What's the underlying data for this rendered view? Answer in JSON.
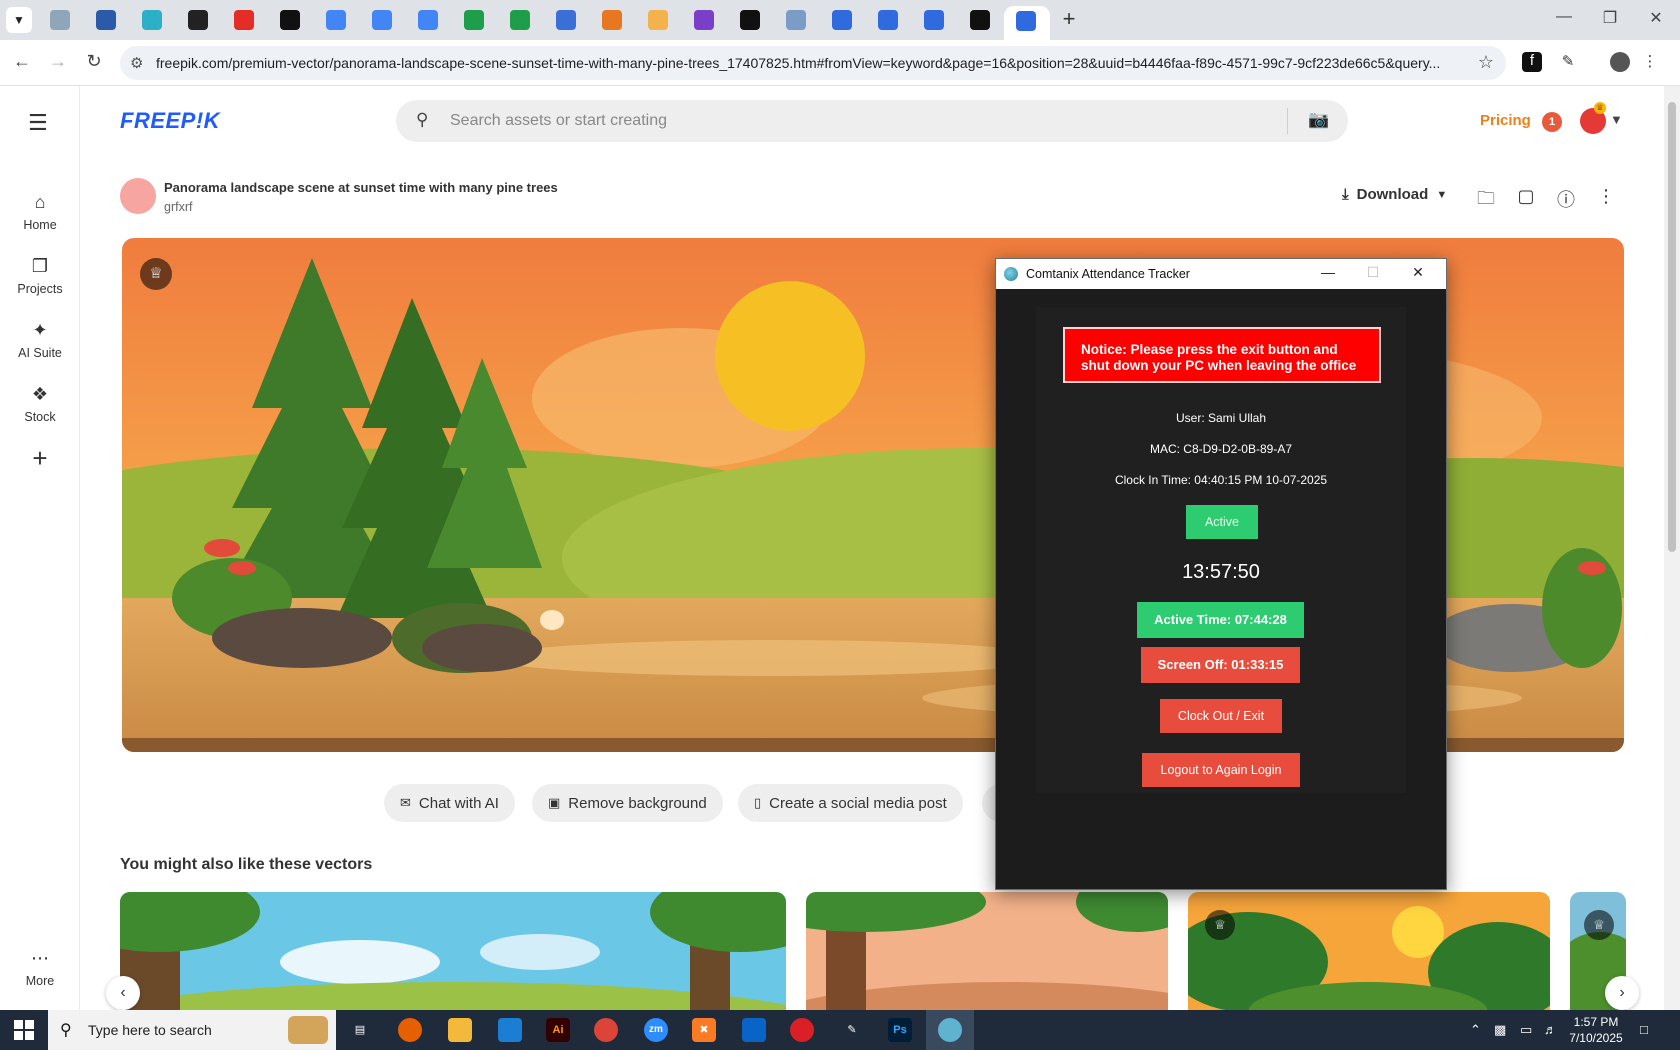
{
  "browser": {
    "url": "freepik.com/premium-vector/panorama-landscape-scene-sunset-time-with-many-pine-trees_17407825.htm#fromView=keyword&page=16&position=28&uuid=b4446faa-f89c-4571-99c7-9cf223de66c5&query...",
    "tab_colors": [
      "#8fa6b8",
      "#2b5aa8",
      "#2bb0c8",
      "#222",
      "#e52d27",
      "#111",
      "#4285f4",
      "#4285f4",
      "#4285f4",
      "#1e9e4a",
      "#1e9e4a",
      "#3a6fd8",
      "#e87722",
      "#f3b24c",
      "#7a3fc9",
      "#111",
      "#7a9cc6",
      "#2f6bde",
      "#2f6bde",
      "#2f6bde",
      "#111",
      "#2f6bde"
    ]
  },
  "site": {
    "logo": "FREEP!K",
    "search_placeholder": "Search assets or start creating",
    "pricing": "Pricing",
    "notif_count": "1"
  },
  "leftnav": {
    "items": [
      {
        "label": "Home",
        "icon": "home-icon"
      },
      {
        "label": "Projects",
        "icon": "projects-icon"
      },
      {
        "label": "AI Suite",
        "icon": "sparkle-icon"
      },
      {
        "label": "Stock",
        "icon": "stock-icon"
      }
    ],
    "more": "More"
  },
  "asset": {
    "title": "Panorama landscape scene at sunset time with many pine trees",
    "author": "grfxrf",
    "download": "Download"
  },
  "chips": [
    "Chat with AI",
    "Remove background",
    "Create a social media post"
  ],
  "recommendations": {
    "title": "You might also like these vectors"
  },
  "tracker": {
    "title": "Comtanix Attendance Tracker",
    "notice": "Notice: Please press the exit button and shut down your PC when leaving the office",
    "user": "User: Sami Ullah",
    "mac": "MAC: C8-D9-D2-0B-89-A7",
    "clock_in": "Clock In Time: 04:40:15 PM 10-07-2025",
    "status": "Active",
    "clock": "13:57:50",
    "active_time": "Active Time: 07:44:28",
    "screen_off": "Screen Off: 01:33:15",
    "clock_out": "Clock Out / Exit",
    "logout": "Logout to Again Login",
    "colors": {
      "green": "#2ecc71",
      "red": "#e74c3c"
    }
  },
  "taskbar": {
    "search_text": "Type here to search",
    "time": "1:57 PM",
    "date": "7/10/2025"
  }
}
